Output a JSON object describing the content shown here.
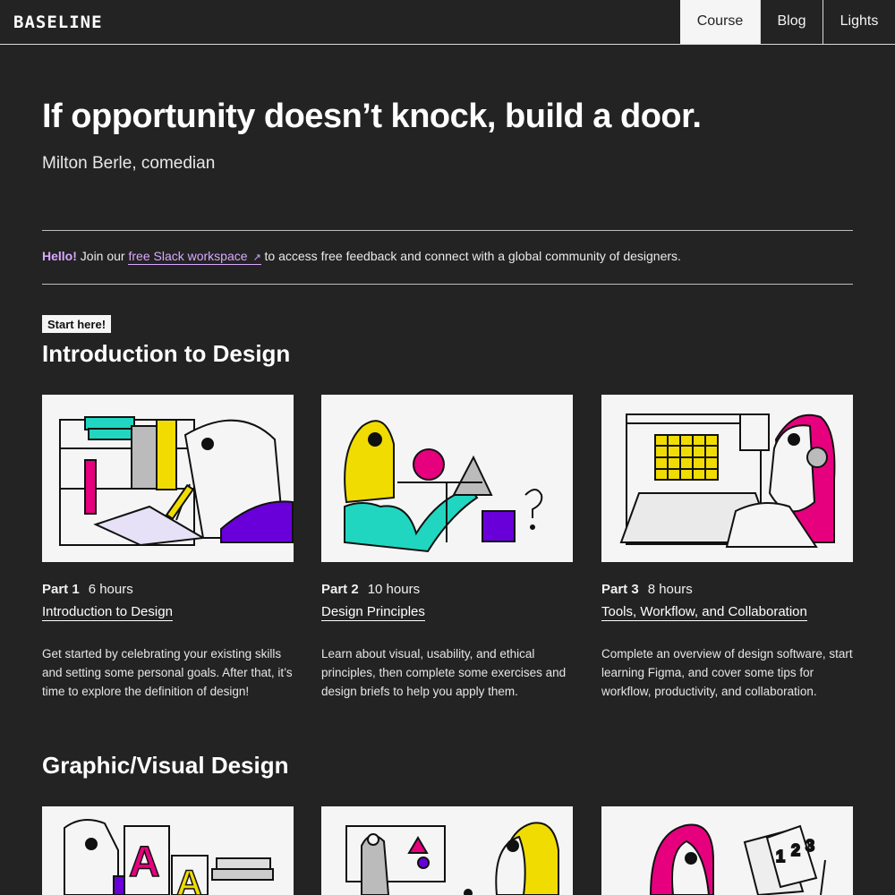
{
  "header": {
    "logo": "BASELINE",
    "nav": [
      {
        "label": "Course",
        "active": true
      },
      {
        "label": "Blog",
        "active": false
      },
      {
        "label": "Lights",
        "active": false
      }
    ]
  },
  "quote": {
    "text": "If opportunity doesn’t knock, build a door.",
    "author": "Milton Berle, comedian"
  },
  "banner": {
    "hello": "Hello!",
    "pre": " Join our ",
    "link": "free Slack workspace",
    "link_icon": "↗",
    "post": " to access free feedback and connect with a global community of designers."
  },
  "section1": {
    "pill": "Start here!",
    "title": "Introduction to Design",
    "cards": [
      {
        "part": "Part 1",
        "hours": "6 hours",
        "title": "Introduction to Design",
        "desc": "Get started by celebrating your existing skills and setting some personal goals. After that, it’s time to explore the definition of design!"
      },
      {
        "part": "Part 2",
        "hours": "10 hours",
        "title": "Design Principles",
        "desc": "Learn about visual, usability, and ethical principles, then complete some exercises and design briefs to help you apply them."
      },
      {
        "part": "Part 3",
        "hours": "8 hours",
        "title": "Tools, Workflow, and Collaboration",
        "desc": "Complete an overview of design software, start learning Figma, and cover some tips for workflow, productivity, and collaboration."
      }
    ]
  },
  "section2": {
    "title": "Graphic/Visual Design",
    "illustration_text": [
      "A",
      "A",
      "1",
      "2",
      "3"
    ]
  },
  "colors": {
    "background": "#232323",
    "accent_purple": "#6a00d9",
    "accent_magenta": "#e6007e",
    "accent_yellow": "#f0dc00",
    "accent_teal": "#21d6c0",
    "link_lavender": "#d9a8ff"
  }
}
